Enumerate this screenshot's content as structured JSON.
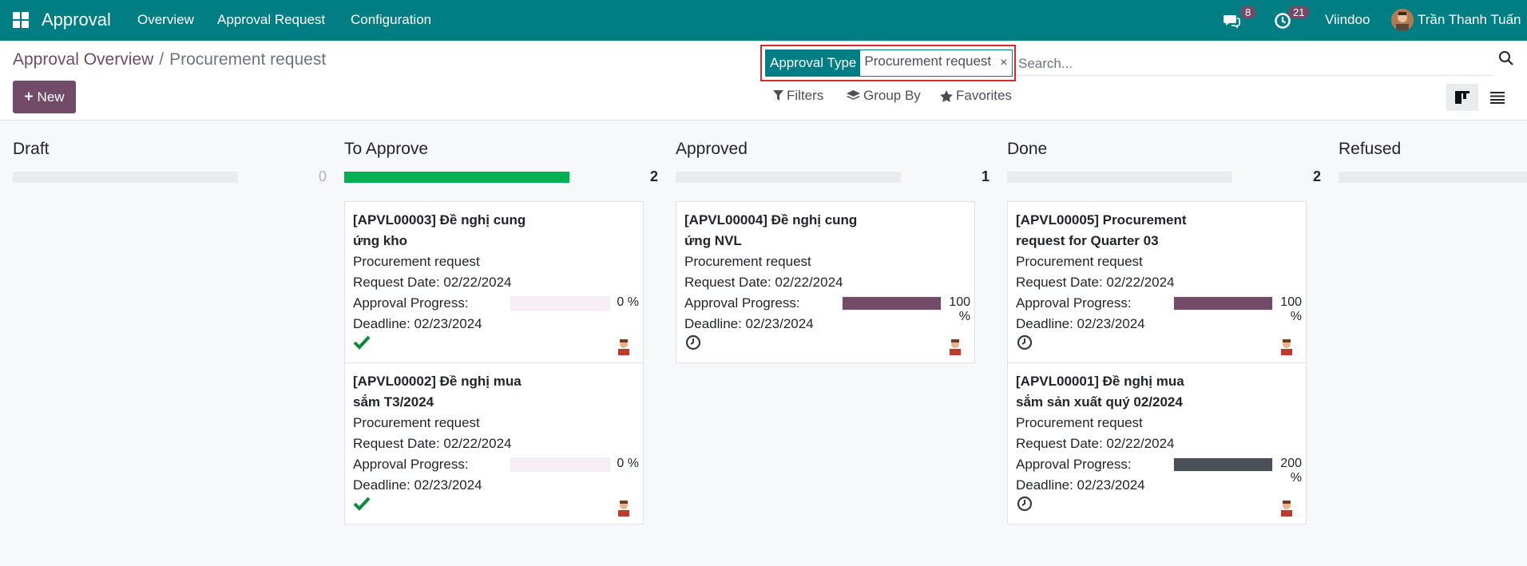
{
  "topbar": {
    "brand": "Approval",
    "menu": [
      "Overview",
      "Approval Request",
      "Configuration"
    ],
    "messages_count": "8",
    "activities_count": "21",
    "company": "Viindoo",
    "user": "Trần Thanh Tuấn"
  },
  "breadcrumb": {
    "parent": "Approval Overview",
    "separator": "/",
    "current": "Procurement request"
  },
  "new_button": "New",
  "search": {
    "facet_label": "Approval Type",
    "facet_value": "Procurement request",
    "facet_remove": "×",
    "placeholder": "Search..."
  },
  "filters": {
    "filters_label": "Filters",
    "group_by_label": "Group By",
    "favorites_label": "Favorites"
  },
  "colors": {
    "brand": "#017e84",
    "accent": "#714b67",
    "success": "#00b052",
    "dark": "#4a4f59"
  },
  "columns": [
    {
      "title": "Draft",
      "count": "0",
      "progress": 0
    },
    {
      "title": "To Approve",
      "count": "2",
      "progress": 100
    },
    {
      "title": "Approved",
      "count": "1",
      "progress": 0
    },
    {
      "title": "Done",
      "count": "2",
      "progress": 0
    },
    {
      "title": "Refused",
      "count": "",
      "progress": 0
    }
  ],
  "cards": {
    "c1": {
      "title": "[APVL00003] Đề nghị cung ứng kho",
      "type": "Procurement request",
      "request_date": "Request Date: 02/22/2024",
      "progress_label": "Approval Progress:",
      "progress": 0,
      "progress_text": "0 %",
      "deadline": "Deadline: 02/23/2024",
      "state_icon": "check-icon"
    },
    "c2": {
      "title": "[APVL00002] Đề nghị mua sắm T3/2024",
      "type": "Procurement request",
      "request_date": "Request Date: 02/22/2024",
      "progress_label": "Approval Progress:",
      "progress": 0,
      "progress_text": "0 %",
      "deadline": "Deadline: 02/23/2024",
      "state_icon": "check-icon"
    },
    "c3": {
      "title": "[APVL00004] Đề nghị cung ứng NVL",
      "type": "Procurement request",
      "request_date": "Request Date: 02/22/2024",
      "progress_label": "Approval Progress:",
      "progress": 100,
      "progress_text": "100 %",
      "deadline": "Deadline: 02/23/2024",
      "state_icon": "clock-icon"
    },
    "c4": {
      "title": "[APVL00005] Procurement request for Quarter 03",
      "type": "Procurement request",
      "request_date": "Request Date: 02/22/2024",
      "progress_label": "Approval Progress:",
      "progress": 100,
      "progress_text": "100 %",
      "deadline": "Deadline: 02/23/2024",
      "state_icon": "clock-icon"
    },
    "c5": {
      "title": "[APVL00001] Đề nghị mua sắm sản xuất quý 02/2024",
      "type": "Procurement request",
      "request_date": "Request Date: 02/22/2024",
      "progress_label": "Approval Progress:",
      "progress": 200,
      "progress_text": "200 %",
      "deadline": "Deadline: 02/23/2024",
      "state_icon": "clock-icon"
    }
  }
}
